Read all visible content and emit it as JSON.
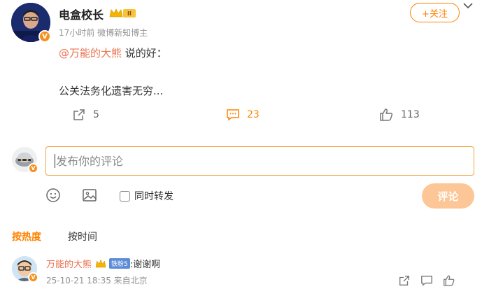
{
  "post": {
    "author": "电盒校长",
    "meta": "17小时前  微博新知博主",
    "follow_label": "+关注",
    "mention": "@万能的大熊",
    "text_after_mention": " 说的好：",
    "text_body": "公关法务化遗害无穷...",
    "vip_level": "II",
    "verified_badge": "V",
    "actions": {
      "repost_count": "5",
      "comment_count": "23",
      "like_count": "113"
    }
  },
  "composer": {
    "placeholder": "发布你的评论",
    "repost_label": "同时转发",
    "submit_label": "评论",
    "avatar_badge": "V"
  },
  "sort_tabs": {
    "hot": "按热度",
    "time": "按时间"
  },
  "reply": {
    "name": "万能的大熊",
    "fan_badge": "铁粉5",
    "text": ":谢谢啊",
    "meta": "25-10-21 18:35  来自北京",
    "avatar_badge": "V"
  },
  "colors": {
    "accent": "#ff8200",
    "mention": "#eb7350",
    "submit_disabled": "#fdc696"
  }
}
